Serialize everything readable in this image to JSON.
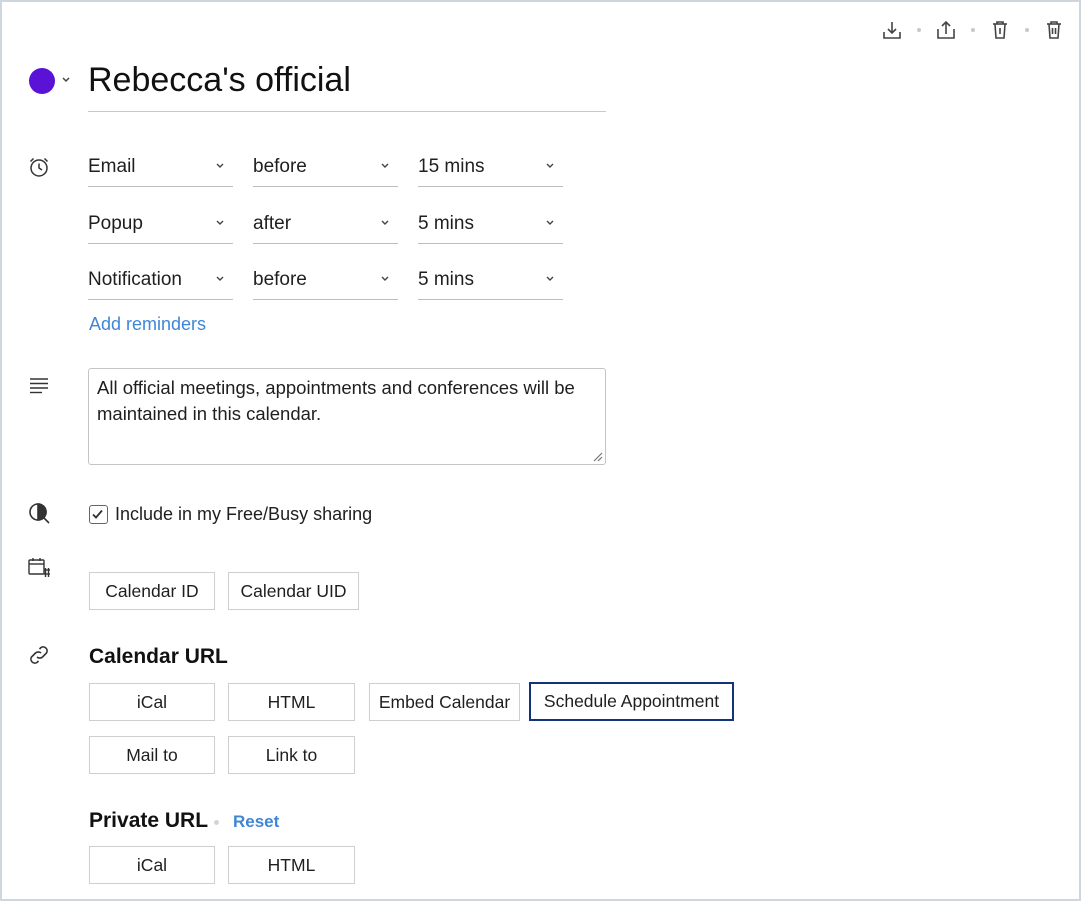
{
  "toolbar": {
    "icons": [
      "download-icon",
      "share-icon",
      "unsubscribe-icon",
      "delete-icon"
    ]
  },
  "calendar": {
    "name": "Rebecca's official",
    "color": "#5a12d6"
  },
  "reminders": [
    {
      "type": "Email",
      "when": "before",
      "duration": "15 mins"
    },
    {
      "type": "Popup",
      "when": "after",
      "duration": "5 mins"
    },
    {
      "type": "Notification",
      "when": "before",
      "duration": "5 mins"
    }
  ],
  "add_reminders_label": "Add reminders",
  "description": "All official meetings, appointments and conferences will be maintained in this calendar.",
  "freebusy": {
    "label": "Include in my Free/Busy sharing",
    "checked": true
  },
  "id_buttons": {
    "calendar_id": "Calendar ID",
    "calendar_uid": "Calendar UID"
  },
  "calendar_url": {
    "heading": "Calendar URL",
    "buttons": [
      "iCal",
      "HTML",
      "Embed Calendar",
      "Schedule Appointment",
      "Mail to",
      "Link to"
    ],
    "active": "Schedule Appointment"
  },
  "private_url": {
    "heading": "Private URL",
    "reset_label": "Reset",
    "buttons": [
      "iCal",
      "HTML"
    ]
  }
}
